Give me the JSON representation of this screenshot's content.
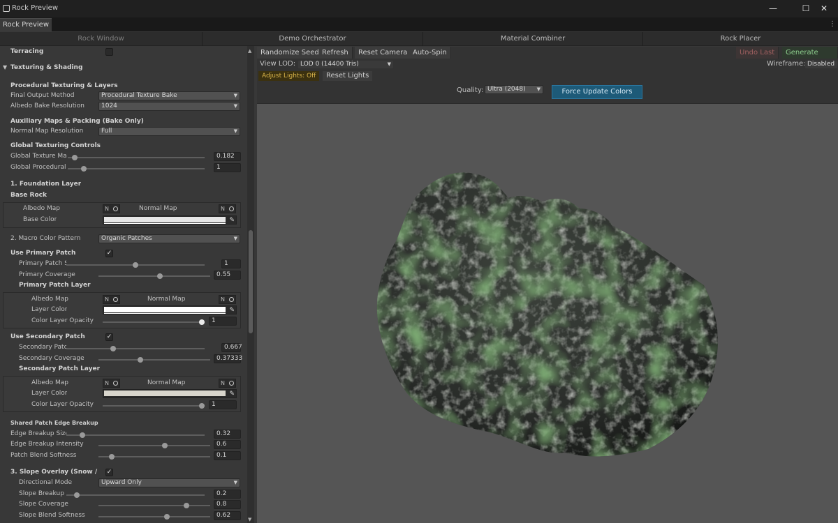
{
  "window": {
    "title": "Rock Preview",
    "tab": "Rock Preview",
    "controls": {
      "minimize": "—",
      "maximize": "☐",
      "close": "✕"
    }
  },
  "window_tabs": [
    {
      "label": "Rock Window",
      "disabled": true
    },
    {
      "label": "Demo Orchestrator",
      "disabled": false
    },
    {
      "label": "Material Combiner",
      "disabled": false
    },
    {
      "label": "Rock Placer",
      "disabled": false
    }
  ],
  "toolbar": {
    "randomize_seed": "Randomize Seed",
    "refresh": "Refresh",
    "reset_camera": "Reset Camera",
    "auto_spin": "Auto-Spin",
    "undo_last": "Undo Last",
    "generate_prefab": "Generate Prefab",
    "view_lod_label": "View LOD:",
    "view_lod_value": "LOD 0 (14400 Tris)",
    "wireframe_label": "Wireframe:",
    "wireframe_value": "Disabled",
    "adjust_lights": "Adjust Lights: Off",
    "reset_lights": "Reset Lights",
    "quality_label": "Quality:",
    "quality_value": "Ultra (2048)",
    "force_update": "Force Update Colors"
  },
  "inspector": {
    "terracing": "Terracing",
    "texturing_header": "Texturing & Shading",
    "proc_header": "Procedural Texturing & Layers",
    "final_output_label": "Final Output Method",
    "final_output_value": "Procedural Texture Bake",
    "albedo_res_label": "Albedo Bake Resolution",
    "albedo_res_value": "1024",
    "aux_header": "Auxiliary Maps & Packing (Bake Only)",
    "normal_res_label": "Normal Map Resolution",
    "normal_res_value": "Full",
    "global_header": "Global Texturing Controls",
    "global_tex_label": "Global Texture Ma",
    "global_tex_value": "0.182",
    "global_tex_level": 0.03,
    "global_proc_label": "Global Procedural",
    "global_proc_value": "1",
    "global_proc_level": 0.1,
    "foundation_header": "1. Foundation Layer",
    "base_rock": "Base Rock",
    "albedo_map": "Albedo Map",
    "normal_map": "Normal Map",
    "none_short": "N",
    "base_color": "Base Color",
    "base_color_hex": "#e6e6e6",
    "macro_label": "2. Macro Color Pattern",
    "macro_value": "Organic Patches",
    "use_primary": "Use Primary Patch",
    "primary_size_label": "Primary Patch S",
    "primary_size_value": "1",
    "primary_size_level": 0.5,
    "primary_cov_label": "Primary Coverage",
    "primary_cov_value": "0.55",
    "primary_cov_level": 0.55,
    "primary_layer": "Primary Patch Layer",
    "layer_color": "Layer Color",
    "primary_color_hex": "#ffffff",
    "color_opacity": "Color Layer Opacity",
    "primary_opacity_value": "1",
    "primary_opacity_level": 1.0,
    "use_secondary": "Use Secondary Patch",
    "secondary_size_label": "Secondary Patc",
    "secondary_size_value": "0.667",
    "secondary_size_level": 0.33,
    "secondary_cov_label": "Secondary Coverage",
    "secondary_cov_value": "0.37333",
    "secondary_cov_level": 0.37,
    "secondary_layer": "Secondary Patch Layer",
    "secondary_color_hex": "#d8d5cc",
    "secondary_opacity_value": "1",
    "secondary_opacity_level": 1.0,
    "shared_header": "Shared Patch Edge Breakup",
    "edge_size_label": "Edge Breakup Size",
    "edge_size_value": "0.32",
    "edge_size_level": 0.1,
    "edge_int_label": "Edge Breakup Intensity",
    "edge_int_value": "0.6",
    "edge_int_level": 0.6,
    "patch_blend_label": "Patch Blend Softness",
    "patch_blend_value": "0.1",
    "patch_blend_level": 0.1,
    "slope_header": "3. Slope Overlay (Snow / Du",
    "dir_mode_label": "Directional Mode",
    "dir_mode_value": "Upward Only",
    "slope_break_label": "Slope Breakup S",
    "slope_break_value": "0.2",
    "slope_break_level": 0.06,
    "slope_cov_label": "Slope Coverage",
    "slope_cov_value": "0.8",
    "slope_cov_level": 0.8,
    "slope_blend_label": "Slope Blend Softness",
    "slope_blend_value": "0.62",
    "slope_blend_level": 0.62
  },
  "colors": {
    "background": "#383838",
    "viewport": "#555555",
    "accent_button": "#1d5a78",
    "rock_dark": "#2c2f2c",
    "moss": "#2f5a2a"
  }
}
